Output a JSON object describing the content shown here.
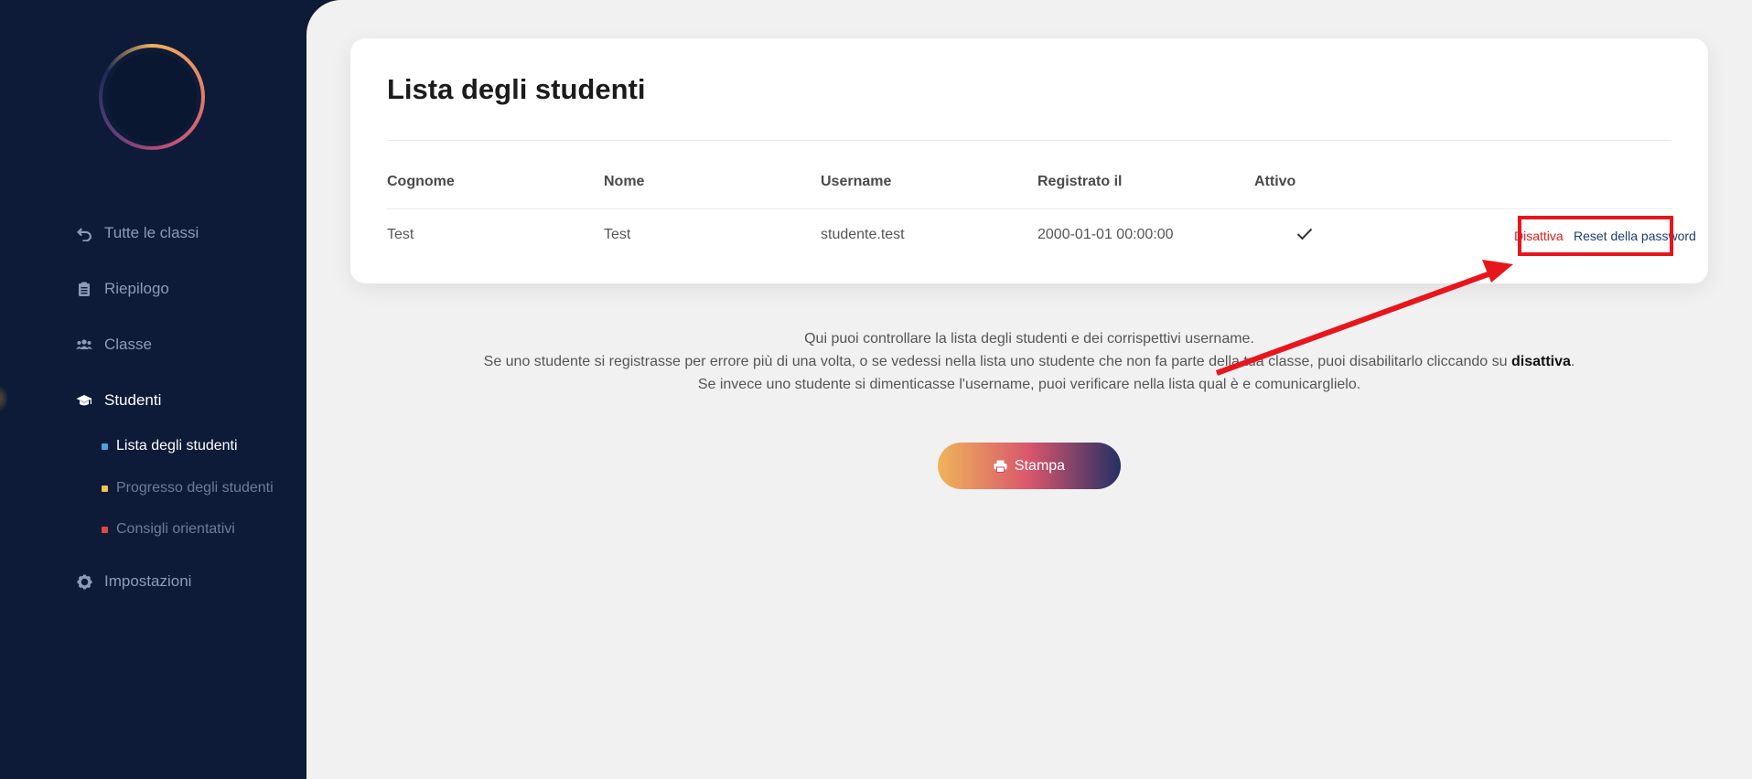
{
  "sidebar": {
    "nav": [
      {
        "label": "Tutte le classi",
        "icon": "undo-icon"
      },
      {
        "label": "Riepilogo",
        "icon": "clipboard-icon"
      },
      {
        "label": "Classe",
        "icon": "users-icon"
      },
      {
        "label": "Studenti",
        "icon": "graduation-cap-icon"
      },
      {
        "label": "Impostazioni",
        "icon": "gear-icon"
      }
    ],
    "subnav": [
      {
        "label": "Lista degli studenti",
        "color": "#4aa3df"
      },
      {
        "label": "Progresso degli studenti",
        "color": "#f2c14e"
      },
      {
        "label": "Consigli orientativi",
        "color": "#e0483e"
      }
    ]
  },
  "card": {
    "title": "Lista degli studenti",
    "headers": [
      "Cognome",
      "Nome",
      "Username",
      "Registrato il",
      "Attivo"
    ],
    "rows": [
      {
        "cognome": "Test",
        "nome": "Test",
        "username": "studente.test",
        "registrato": "2000-01-01 00:00:00",
        "attivo": "check-icon",
        "action_disable": "Disattiva",
        "action_reset": "Reset della password"
      }
    ]
  },
  "info": {
    "line1": "Qui puoi controllare la lista degli studenti e dei corrispettivi username.",
    "line2_pre": "Se uno studente si registrasse per errore più di una volta, o se vedessi nella lista uno studente che non fa parte della tua classe, puoi disabilitarlo cliccando su ",
    "line2_bold": "disattiva",
    "line2_post": ".",
    "line3": "Se invece uno studente si dimenticasse l'username, puoi verificare nella lista qual è e comunicarglielo."
  },
  "print_button": {
    "label": "Stampa",
    "icon": "printer-icon"
  },
  "colors": {
    "sidebar_bg": "#0d1b38",
    "main_bg": "#f1f1f1",
    "danger": "#e02020",
    "link": "#1f3d6e",
    "annotation": "#e8151c"
  }
}
